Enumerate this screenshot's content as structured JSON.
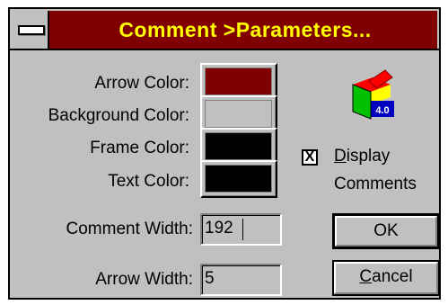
{
  "window": {
    "title": "Comment >Parameters...",
    "colors": {
      "title_bar": "#800000",
      "title_text": "#ffff00",
      "face": "#c0c0c0"
    }
  },
  "colors_section": {
    "arrow_color": {
      "label": "Arrow Color:",
      "value": "#800000"
    },
    "background_color": {
      "label": "Background Color:",
      "value": "#c0c0c0"
    },
    "frame_color": {
      "label": "Frame Color:",
      "value": "#000000"
    },
    "text_color": {
      "label": "Text Color:",
      "value": "#000000"
    }
  },
  "fields": {
    "comment_width": {
      "label": "Comment Width:",
      "value": "192"
    },
    "arrow_width": {
      "label": "Arrow Width:",
      "value": "5"
    }
  },
  "logo": {
    "icon": "app-logo-icon",
    "version_text": "4.0"
  },
  "display_comments": {
    "checked": true,
    "check_mark": "X",
    "label_line1_mnemonic": "D",
    "label_line1_rest": "isplay",
    "label_line2": "Comments"
  },
  "buttons": {
    "ok_label": "OK",
    "cancel_mnemonic": "C",
    "cancel_rest": "ancel"
  }
}
